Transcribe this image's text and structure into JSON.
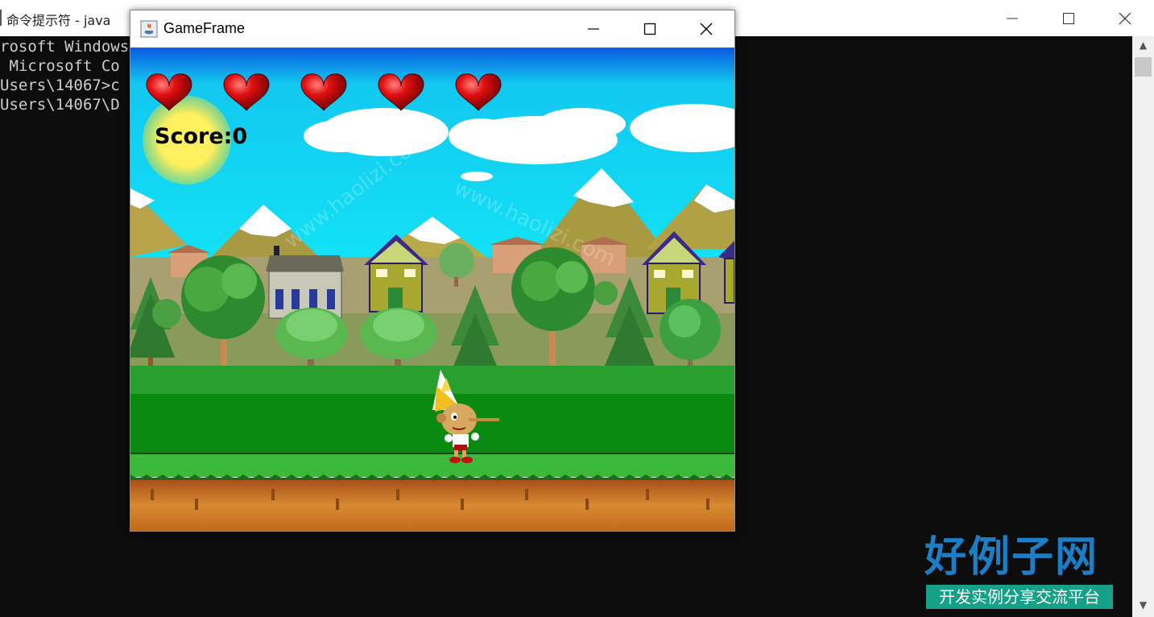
{
  "console": {
    "title": "命令提示符 - java",
    "lines": [
      "rosoft Windows",
      " Microsoft Co",
      "",
      "Users\\14067>c",
      "",
      "Users\\14067\\D"
    ]
  },
  "game_window": {
    "title": "GameFrame",
    "score_text": "Score:0",
    "lives": 5
  },
  "watermark": {
    "main": "好例子网",
    "sub": "开发实例分享交流平台",
    "url": "www.haolizi.com"
  },
  "colors": {
    "sky": "#00e4f4",
    "grass": "#0a8a10",
    "dirt": "#c8701c",
    "heart": "#d10a0a",
    "sun": "#ffef4a"
  }
}
